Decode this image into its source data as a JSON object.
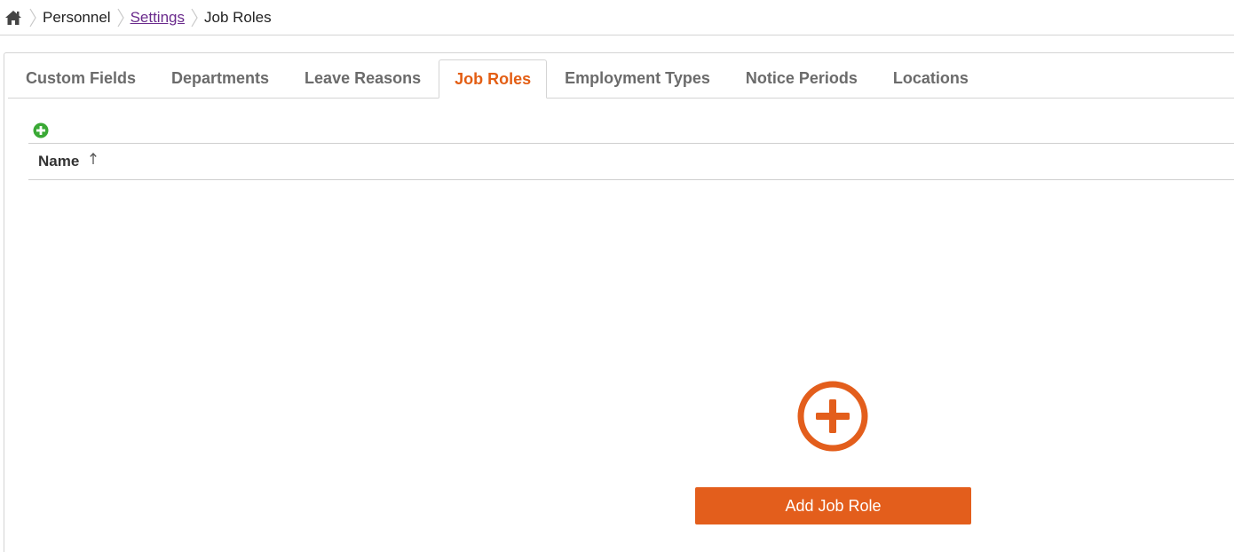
{
  "breadcrumb": {
    "home_icon": "home-icon",
    "items": [
      {
        "label": "Personnel",
        "link": false
      },
      {
        "label": "Settings",
        "link": true
      },
      {
        "label": "Job Roles",
        "link": false
      }
    ]
  },
  "tabs": [
    {
      "label": "Custom Fields",
      "active": false
    },
    {
      "label": "Departments",
      "active": false
    },
    {
      "label": "Leave Reasons",
      "active": false
    },
    {
      "label": "Job Roles",
      "active": true
    },
    {
      "label": "Employment Types",
      "active": false
    },
    {
      "label": "Notice Periods",
      "active": false
    },
    {
      "label": "Locations",
      "active": false
    }
  ],
  "grid": {
    "add_icon": "plus-circle-icon",
    "columns": [
      {
        "label": "Name",
        "sort": "ascending",
        "sort_icon": "sort-up-arrow-icon"
      }
    ],
    "rows": []
  },
  "empty_state": {
    "icon": "plus-circle-icon",
    "button_label": "Add Job Role"
  },
  "colors": {
    "accent": "#e35e1c",
    "active_tab": "#e35e14",
    "add_green": "#3aa935",
    "link": "#6a2a8c"
  }
}
